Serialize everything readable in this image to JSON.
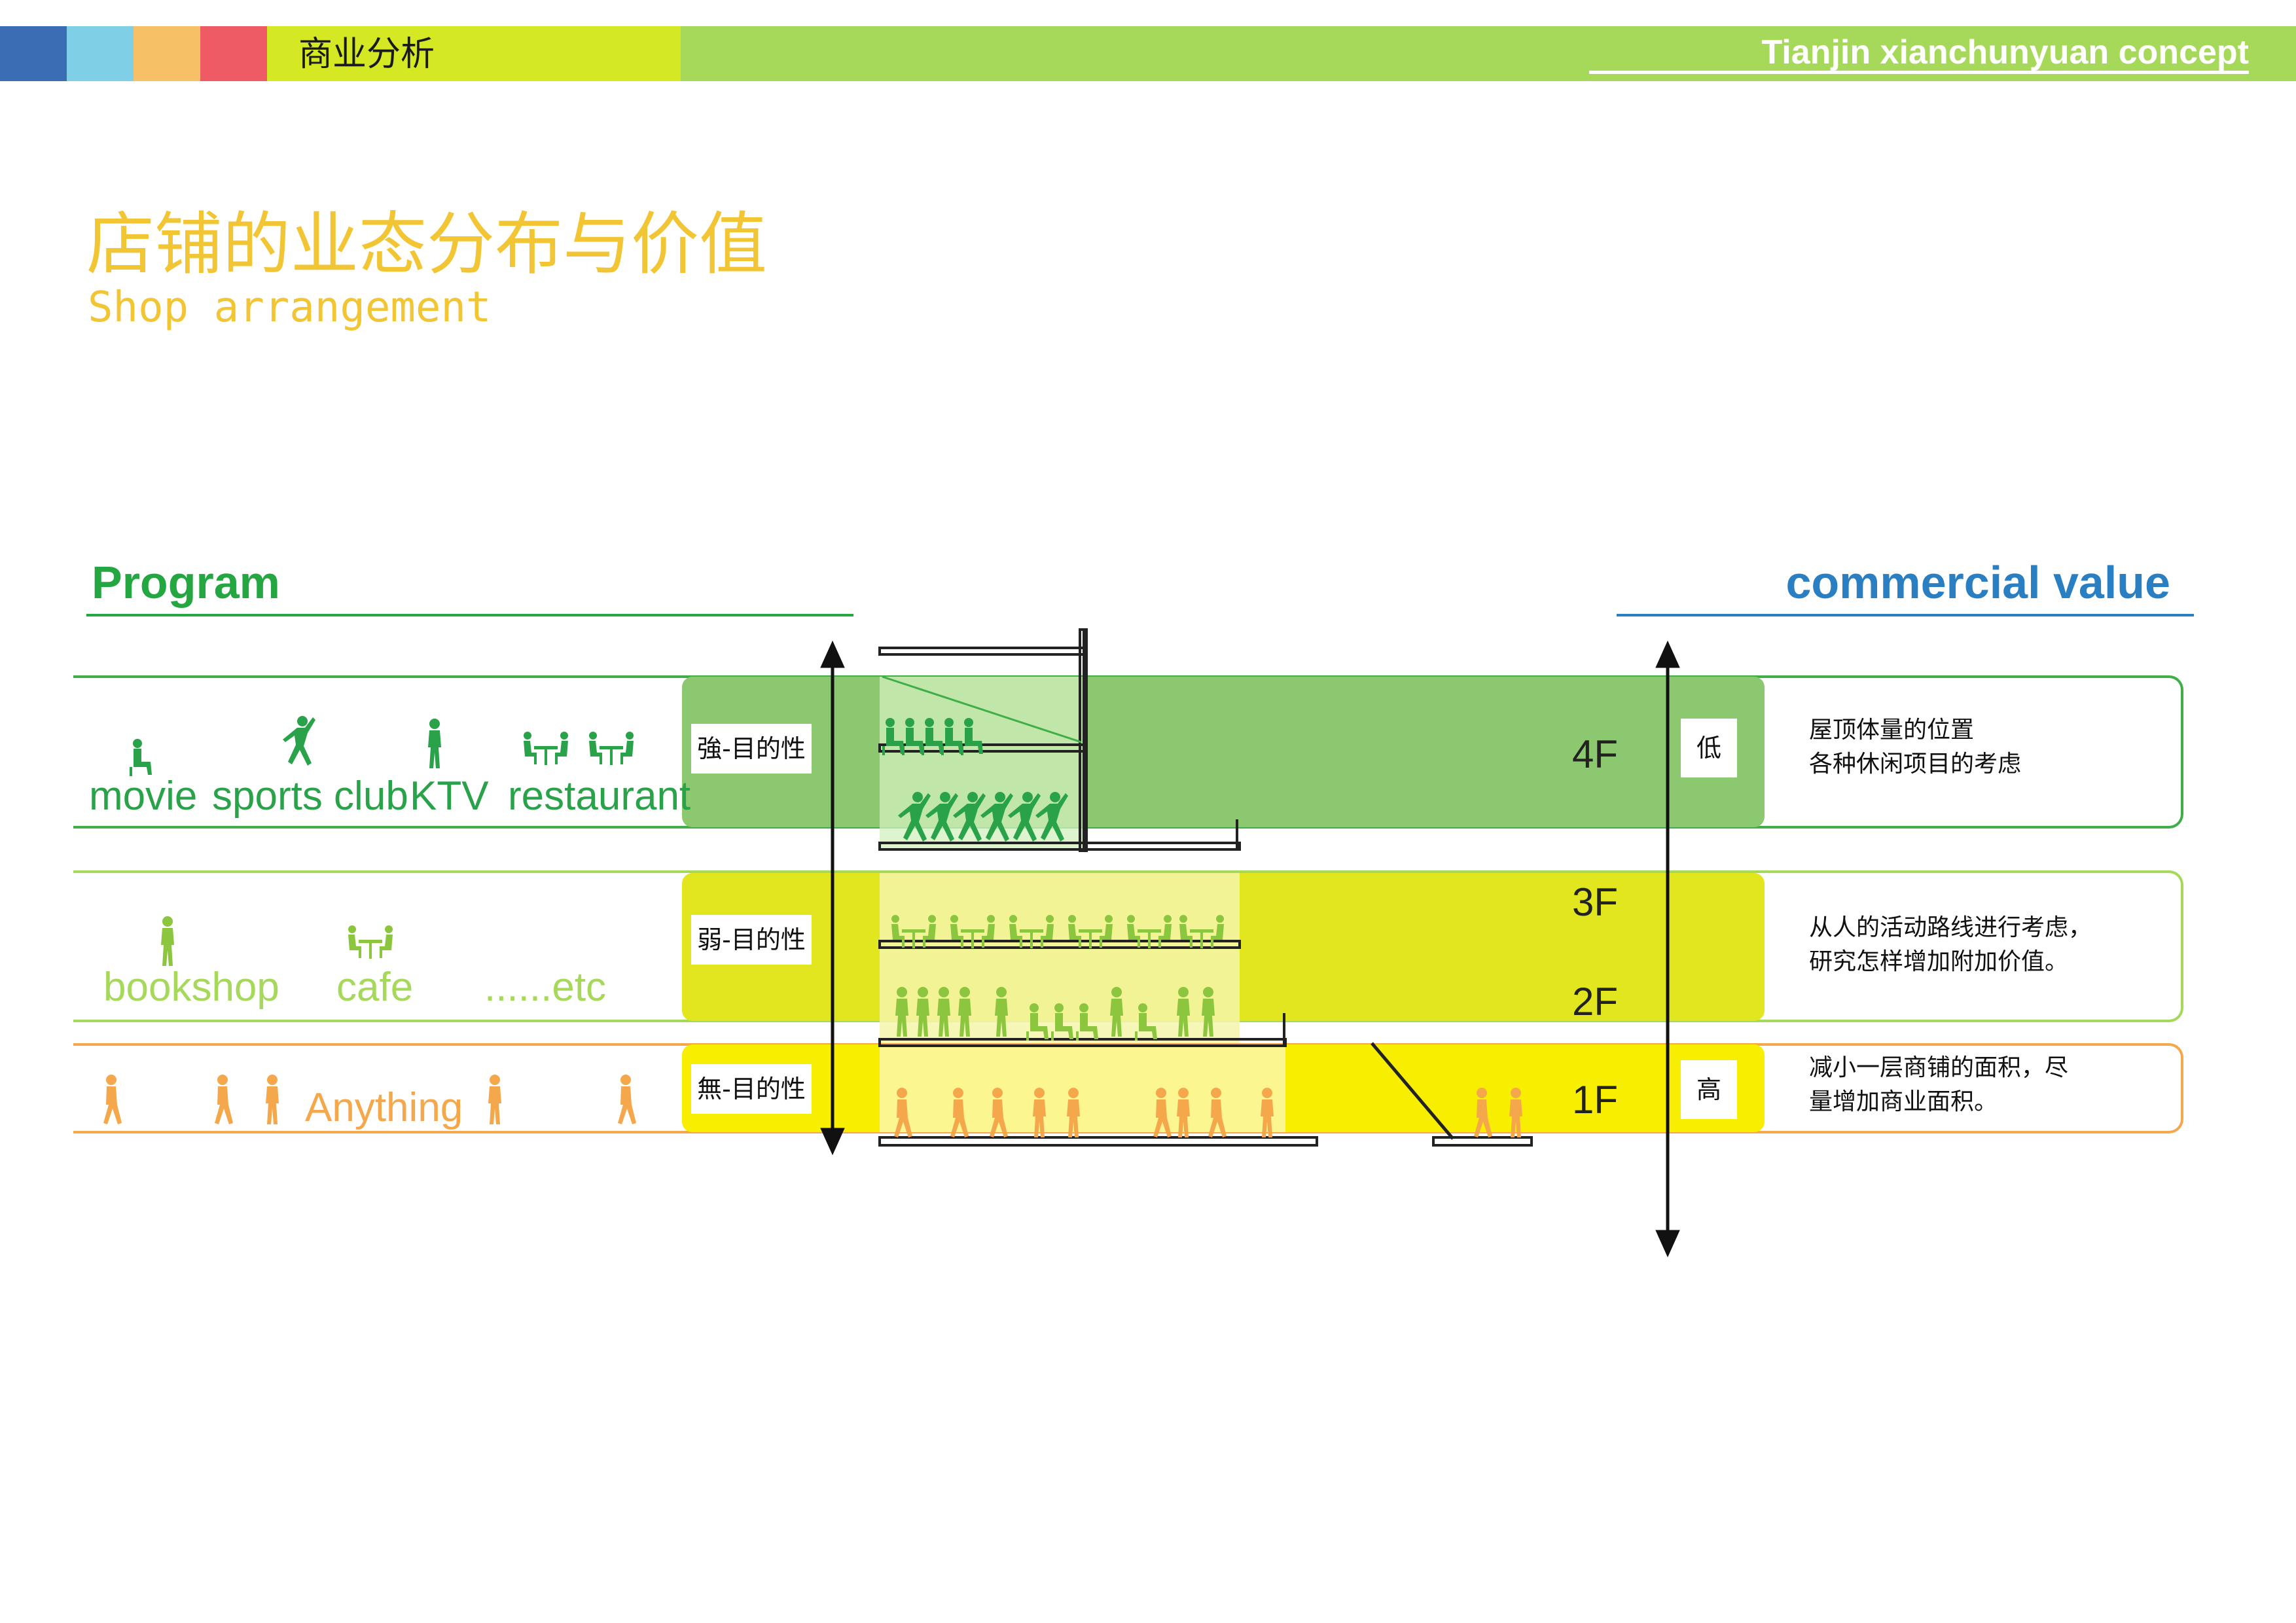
{
  "header": {
    "section": "商业分析",
    "project": "Tianjin xianchunyuan concept",
    "colors": {
      "blue": "#3a6db4",
      "cyan": "#7fcfe6",
      "orange": "#f6c067",
      "red": "#ef5b64",
      "lime": "#d4e823",
      "green": "#a6d95a"
    }
  },
  "title": {
    "cn": "店铺的业态分布与价值",
    "en": "Shop arrangement"
  },
  "sections": {
    "left": "Program",
    "right": "commercial value"
  },
  "rows": [
    {
      "programs": [
        "movie",
        "sports club",
        "KTV",
        "restaurant"
      ],
      "tag": "強-目的性",
      "floors": [
        "4F"
      ],
      "value": "低",
      "note": "屋顶体量的位置\n各种休闲项目的考虑",
      "color": "#8cc870"
    },
    {
      "programs": [
        "bookshop",
        "cafe",
        "......etc"
      ],
      "tag": "弱-目的性",
      "floors": [
        "3F",
        "2F"
      ],
      "value": "",
      "note": "从人的活动路线进行考虑，\n研究怎样增加附加价值。",
      "color": "#e2e61e"
    },
    {
      "programs": [
        "Anything"
      ],
      "tag": "無-目的性",
      "floors": [
        "1F"
      ],
      "value": "高",
      "note": "减小一层商铺的面积，尽\n量增加商业面积。",
      "color": "#f8ee00"
    }
  ]
}
